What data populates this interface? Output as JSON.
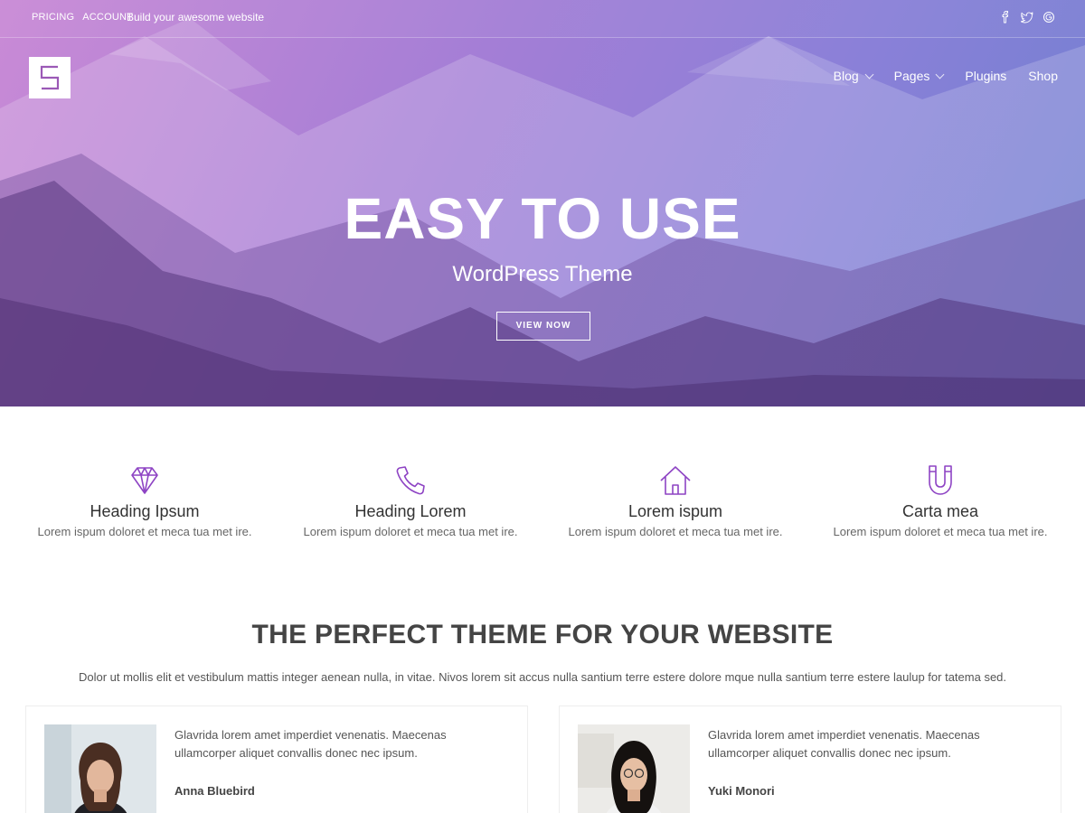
{
  "topbar": {
    "links": [
      "PRICING",
      "ACCOUNT"
    ],
    "tagline": "Build your awesome website",
    "social": [
      "facebook-icon",
      "twitter-icon",
      "google-icon"
    ]
  },
  "logo": {
    "letter": "S"
  },
  "nav": {
    "items": [
      {
        "label": "Blog",
        "has_dropdown": true
      },
      {
        "label": "Pages",
        "has_dropdown": true
      },
      {
        "label": "Plugins",
        "has_dropdown": false
      },
      {
        "label": "Shop",
        "has_dropdown": false
      }
    ]
  },
  "hero": {
    "title": "EASY TO USE",
    "subtitle": "WordPress Theme",
    "button": "VIEW NOW"
  },
  "features": [
    {
      "icon": "diamond-icon",
      "title": "Heading Ipsum",
      "text": "Lorem ispum doloret et meca tua met ire."
    },
    {
      "icon": "phone-icon",
      "title": "Heading Lorem",
      "text": "Lorem ispum doloret et meca tua met ire."
    },
    {
      "icon": "home-icon",
      "title": "Lorem ispum",
      "text": "Lorem ispum doloret et meca tua met ire."
    },
    {
      "icon": "magnet-icon",
      "title": "Carta mea",
      "text": "Lorem ispum doloret et meca tua met ire."
    }
  ],
  "section": {
    "title": "THE PERFECT THEME FOR YOUR WEBSITE",
    "text": "Dolor ut mollis elit et vestibulum mattis integer aenean nulla, in vitae. Nivos lorem sit accus nulla santium terre estere dolore mque nulla santium terre estere laulup for tatema sed."
  },
  "testimonials": [
    {
      "quote": "Glavrida lorem amet imperdiet venenatis. Maecenas ullamcorper aliquet convallis donec nec ipsum.",
      "name": "Anna Bluebird"
    },
    {
      "quote": "Glavrida lorem amet imperdiet venenatis. Maecenas ullamcorper aliquet convallis donec nec ipsum.",
      "name": "Yuki Monori"
    }
  ],
  "colors": {
    "accent": "#8e44c4",
    "hero_start": "#c98ad6",
    "hero_end": "#6f7fd0",
    "text_dark": "#444444"
  }
}
